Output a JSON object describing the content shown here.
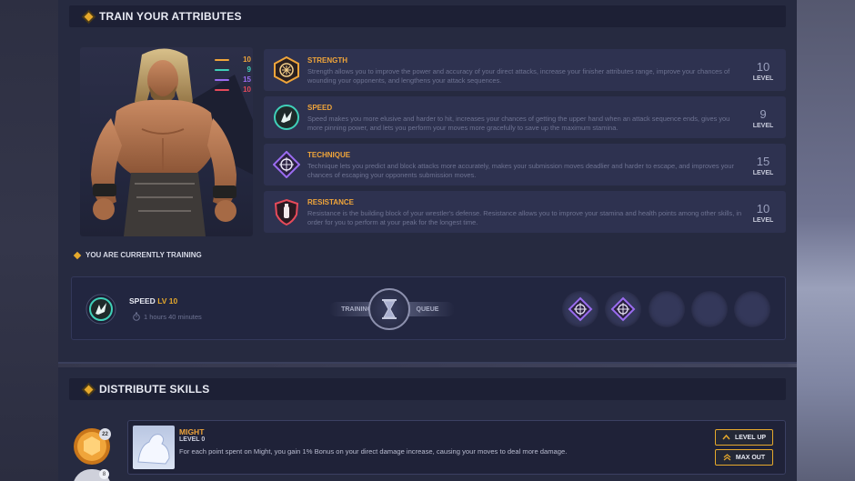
{
  "train_section": {
    "title": "TRAIN YOUR ATTRIBUTES"
  },
  "legend": [
    {
      "value": "10",
      "color": "#f0a53a"
    },
    {
      "value": "9",
      "color": "#3fd0b8"
    },
    {
      "value": "15",
      "color": "#9a6cf0"
    },
    {
      "value": "10",
      "color": "#e54a5a"
    }
  ],
  "attributes": [
    {
      "name": "STRENGTH",
      "description": "Strength allows you to improve the power and accuracy of your direct attacks, increase your finisher attributes range, improve your chances of wounding your opponents, and lengthens your attack sequences.",
      "level": "10",
      "level_label": "LEVEL",
      "icon": "fist-icon",
      "color": "#f0a53a"
    },
    {
      "name": "SPEED",
      "description": "Speed makes you more elusive and harder to hit, increases your chances of getting the upper hand when an attack sequence ends, gives you more pinning power, and lets you perform your moves more gracefully to save up the maximum stamina.",
      "level": "9",
      "level_label": "LEVEL",
      "icon": "winged-foot-icon",
      "color": "#3fd0b8"
    },
    {
      "name": "TECHNIQUE",
      "description": "Technique lets you predict and block attacks more accurately, makes your submission moves deadlier and harder to escape, and improves your chances of escaping your opponents submission moves.",
      "level": "15",
      "level_label": "LEVEL",
      "icon": "crosshair-icon",
      "color": "#9a6cf0"
    },
    {
      "name": "RESISTANCE",
      "description": "Resistance is the building block of your wrestler's defense. Resistance allows you to improve your stamina and health points among other skills, in order for you to perform at your peak for the longest time.",
      "level": "10",
      "level_label": "LEVEL",
      "icon": "shield-bottle-icon",
      "color": "#e54a5a"
    }
  ],
  "training": {
    "heading": "YOU ARE CURRENTLY TRAINING",
    "name": "SPEED",
    "level": "LV 10",
    "time": "1 hours 40 minutes",
    "training_label": "TRAINING",
    "queue_label": "QUEUE",
    "queue_slots": [
      "crosshair-icon",
      "crosshair-icon",
      "empty",
      "empty",
      "empty"
    ]
  },
  "distribute_section": {
    "title": "DISTRIBUTE SKILLS"
  },
  "skill_coins": [
    "22",
    "8"
  ],
  "skill": {
    "name": "MIGHT",
    "level": "LEVEL 0",
    "description": "For each point spent on Might, you gain 1% Bonus on your direct damage increase, causing your moves to deal more damage.",
    "level_up_label": "LEVEL UP",
    "max_out_label": "MAX OUT"
  }
}
